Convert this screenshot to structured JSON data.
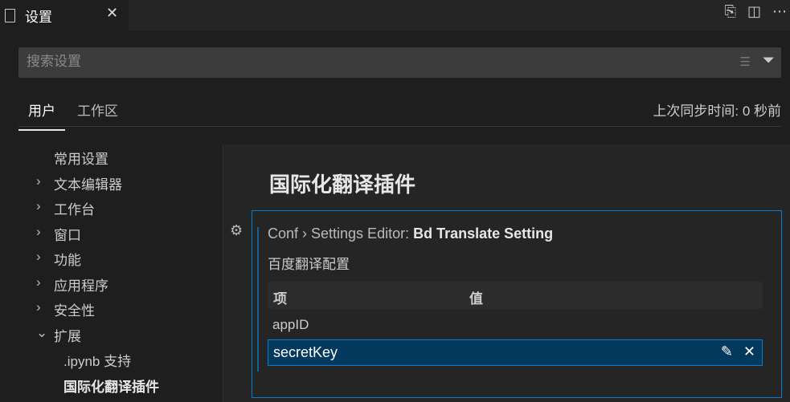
{
  "tab": {
    "title": "设置"
  },
  "search": {
    "placeholder": "搜索设置"
  },
  "scopes": {
    "user": "用户",
    "workspace": "工作区",
    "sync": "上次同步时间: 0 秒前"
  },
  "toc": [
    {
      "label": "常用设置",
      "chevron": ""
    },
    {
      "label": "文本编辑器",
      "chevron": ">"
    },
    {
      "label": "工作台",
      "chevron": ">"
    },
    {
      "label": "窗口",
      "chevron": ">"
    },
    {
      "label": "功能",
      "chevron": ">"
    },
    {
      "label": "应用程序",
      "chevron": ">"
    },
    {
      "label": "安全性",
      "chevron": ">"
    },
    {
      "label": "扩展",
      "chevron": "v"
    },
    {
      "label": ".ipynb 支持",
      "chevron": ""
    },
    {
      "label": "国际化翻译插件",
      "chevron": ""
    }
  ],
  "section": {
    "title": "国际化翻译插件"
  },
  "setting": {
    "prefix": "Conf › Settings Editor: ",
    "name": "Bd Translate Setting",
    "description": "百度翻译配置",
    "col_item": "项",
    "col_value": "值",
    "rows": [
      "appID",
      "secretKey"
    ]
  }
}
